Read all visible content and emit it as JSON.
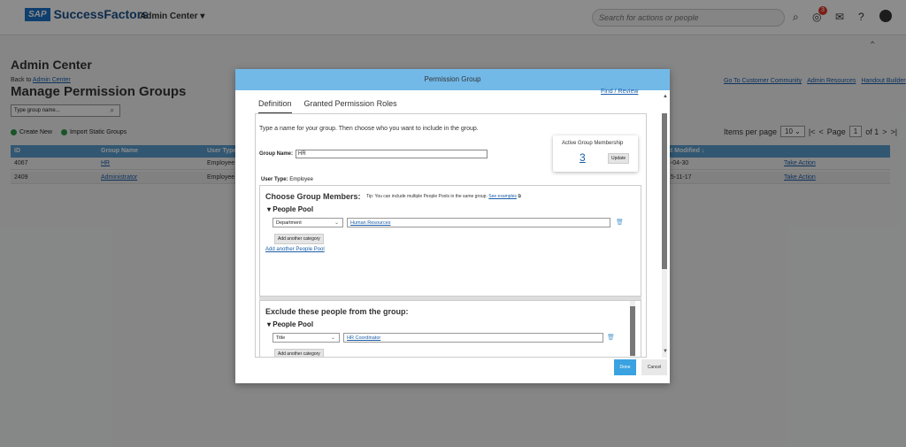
{
  "topbar": {
    "logo_sap": "SAP",
    "logo_name": "SuccessFactors",
    "module": "Admin Center",
    "search_placeholder": "Search for actions or people",
    "notification_count": "3"
  },
  "page": {
    "admin_title": "Admin Center",
    "back_prefix": "Back to",
    "back_link": "Admin Center",
    "title": "Manage Permission Groups",
    "links": [
      "Go To Customer Community",
      "Admin Resources",
      "Handout Builder"
    ],
    "search_placeholder": "Type group name...",
    "actions": [
      "Create New",
      "Import Static Groups"
    ],
    "pager": {
      "items_label": "Items per page",
      "items_value": "10",
      "page_label": "Page",
      "page_value": "1",
      "of_label": "of 1"
    }
  },
  "grid": {
    "headers": [
      "ID",
      "Group Name",
      "User Type",
      "st Modified ↓"
    ],
    "rows": [
      {
        "id": "4067",
        "name": "HR",
        "user_type": "Employee",
        "modified": "4-04-30",
        "action": "Take Action"
      },
      {
        "id": "2409",
        "name": "Administrator",
        "user_type": "Employee",
        "modified": "15-11-17",
        "action": "Take Action"
      }
    ]
  },
  "modal": {
    "title": "Permission Group",
    "tabs": [
      "Definition",
      "Granted Permission Roles"
    ],
    "top_link": "Find / Review",
    "intro": "Type a name for your group. Then choose who you want to include in the group.",
    "group_name_label": "Group Name:",
    "group_name_value": "HR",
    "membership_title": "Active Group Membership",
    "membership_count": "3",
    "update_label": "Update",
    "user_type_label": "User Type:",
    "user_type_value": "Employee",
    "choose_title": "Choose Group Members:",
    "tip_text": "Tip: You can include multiple People Pools in the same group.",
    "tip_link": "See examples",
    "people_pool": "People Pool",
    "include": {
      "category": "Department",
      "value": "Human Resources"
    },
    "add_category": "Add another category",
    "add_pool": "Add another People Pool",
    "exclude_title": "Exclude these people from the group:",
    "exclude": {
      "category": "Title",
      "value": "HR Coordinator"
    },
    "done": "Done",
    "cancel": "Cancel"
  }
}
